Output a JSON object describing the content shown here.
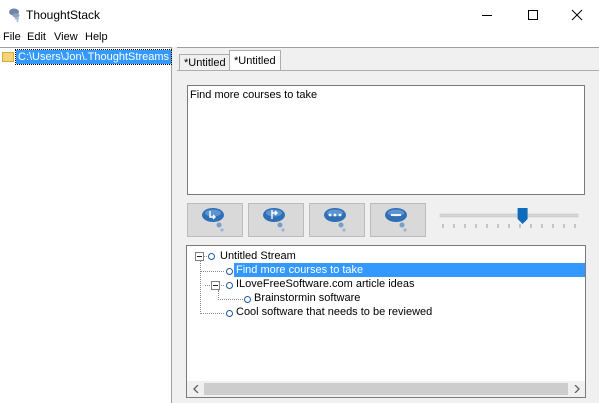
{
  "window": {
    "title": "ThoughtStack",
    "app_icon": "thoughtstack-logo-icon",
    "minimize_icon": "minimize-icon",
    "maximize_icon": "maximize-icon",
    "close_icon": "close-icon"
  },
  "menu": [
    "File",
    "Edit",
    "View",
    "Help"
  ],
  "left_panel": {
    "folder_icon": "folder-icon",
    "folder_path": "C:\\Users\\Jon\\.ThoughtStreams"
  },
  "tabs": [
    {
      "label": "*Untitled",
      "active": false
    },
    {
      "label": "*Untitled",
      "active": true
    }
  ],
  "editor": {
    "text": "Find more courses to take"
  },
  "toolbar": [
    {
      "icon": "add-thought-icon"
    },
    {
      "icon": "add-sub-thought-icon"
    },
    {
      "icon": "more-options-icon"
    },
    {
      "icon": "remove-thought-icon"
    }
  ],
  "slider": {
    "value_fraction": 0.6
  },
  "tree": {
    "root": "Untitled Stream",
    "items": [
      {
        "label": "Find more courses to take",
        "selected": true
      },
      {
        "label": "ILoveFreeSoftware.com article ideas",
        "selected": false
      },
      {
        "label": "Brainstormin software",
        "selected": false
      },
      {
        "label": "Cool software that needs to be reviewed",
        "selected": false
      }
    ]
  },
  "colors": {
    "selection": "#3399ff",
    "toolbar_button": "#d9d9d9",
    "slider_thumb": "#0f6cbd",
    "bubble_blue": "#2f6fb5"
  }
}
